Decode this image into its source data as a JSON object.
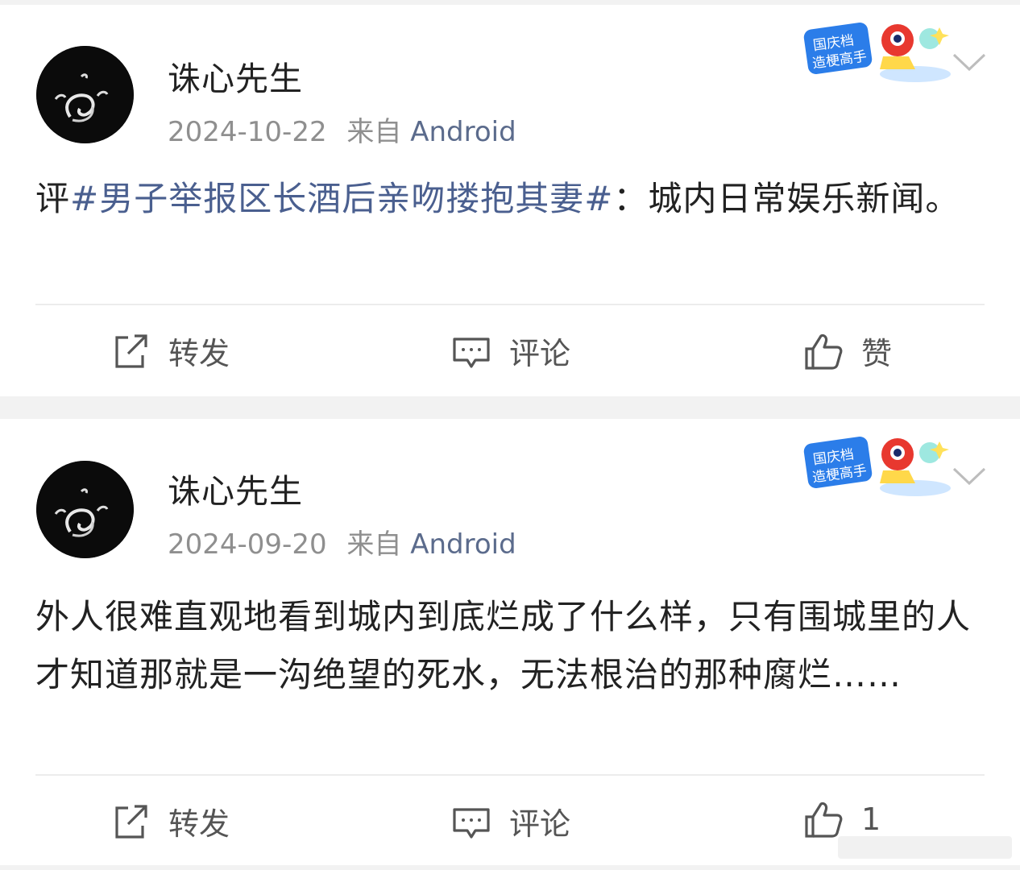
{
  "posts": [
    {
      "username": "诛心先生",
      "date": "2024-10-22",
      "source_prefix": "来自",
      "source": "Android",
      "text_prefix": "评",
      "hashtag": "#男子举报区长酒后亲吻搂抱其妻#",
      "text_suffix": "：城内日常娱乐新闻。",
      "actions": {
        "repost": "转发",
        "comment": "评论",
        "like": "赞"
      }
    },
    {
      "username": "诛心先生",
      "date": "2024-09-20",
      "source_prefix": "来自",
      "source": "Android",
      "text": "外人很难直观地看到城内到底烂成了什么样，只有围城里的人才知道那就是一沟绝望的死水，无法根治的那种腐烂……",
      "actions": {
        "repost": "转发",
        "comment": "评论",
        "like": "1"
      }
    }
  ],
  "badge": {
    "line1": "国庆档",
    "line2": "造梗高手"
  },
  "icons": [
    "repost-icon",
    "comment-icon",
    "like-icon",
    "chevron-down-icon",
    "avatar"
  ]
}
